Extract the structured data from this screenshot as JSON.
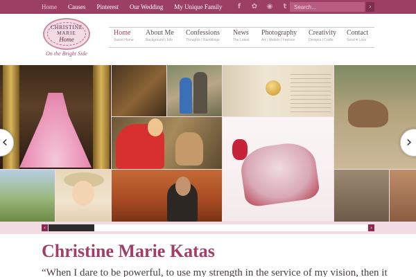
{
  "topnav": {
    "items": [
      {
        "label": "Home",
        "active": true
      },
      {
        "label": "Causes",
        "active": false
      },
      {
        "label": "Pinterest",
        "active": false
      },
      {
        "label": "Our Wedding",
        "active": false
      },
      {
        "label": "My Unique Family",
        "active": false
      }
    ]
  },
  "social": {
    "icons": [
      "facebook-icon",
      "flickr-icon",
      "rss-icon",
      "twitter-icon"
    ],
    "glyphs": [
      "f",
      "✿",
      "◉",
      "t"
    ]
  },
  "search": {
    "placeholder": "Search...",
    "button": "›"
  },
  "logo": {
    "line1": "CHRISTINE",
    "line2": "MARIE",
    "line3": "Home",
    "tagline": "On the Bright Side"
  },
  "mainnav": [
    {
      "label": "Home",
      "sub": "Sweet Home"
    },
    {
      "label": "About Me",
      "sub": "Background | Info"
    },
    {
      "label": "Confessions",
      "sub": "Thoughts | Ramblings"
    },
    {
      "label": "News",
      "sub": "The Latest"
    },
    {
      "label": "Photography",
      "sub": "Art | Models | Fashion"
    },
    {
      "label": "Creativity",
      "sub": "Designs | Crafts"
    },
    {
      "label": "Contact",
      "sub": "Send ♥ Love"
    }
  ],
  "gallery": {
    "prev": "‹",
    "next": "›"
  },
  "slider": {
    "prev": "‹",
    "next": "›"
  },
  "content": {
    "title": "Christine Marie Katas",
    "quote": "“When I dare to be powerful, to use my strength in the service of my vision, then it"
  },
  "colors": {
    "topbar": "#9c3f64",
    "accent": "#a13d66",
    "gallery_bg": "#f1dce4"
  }
}
